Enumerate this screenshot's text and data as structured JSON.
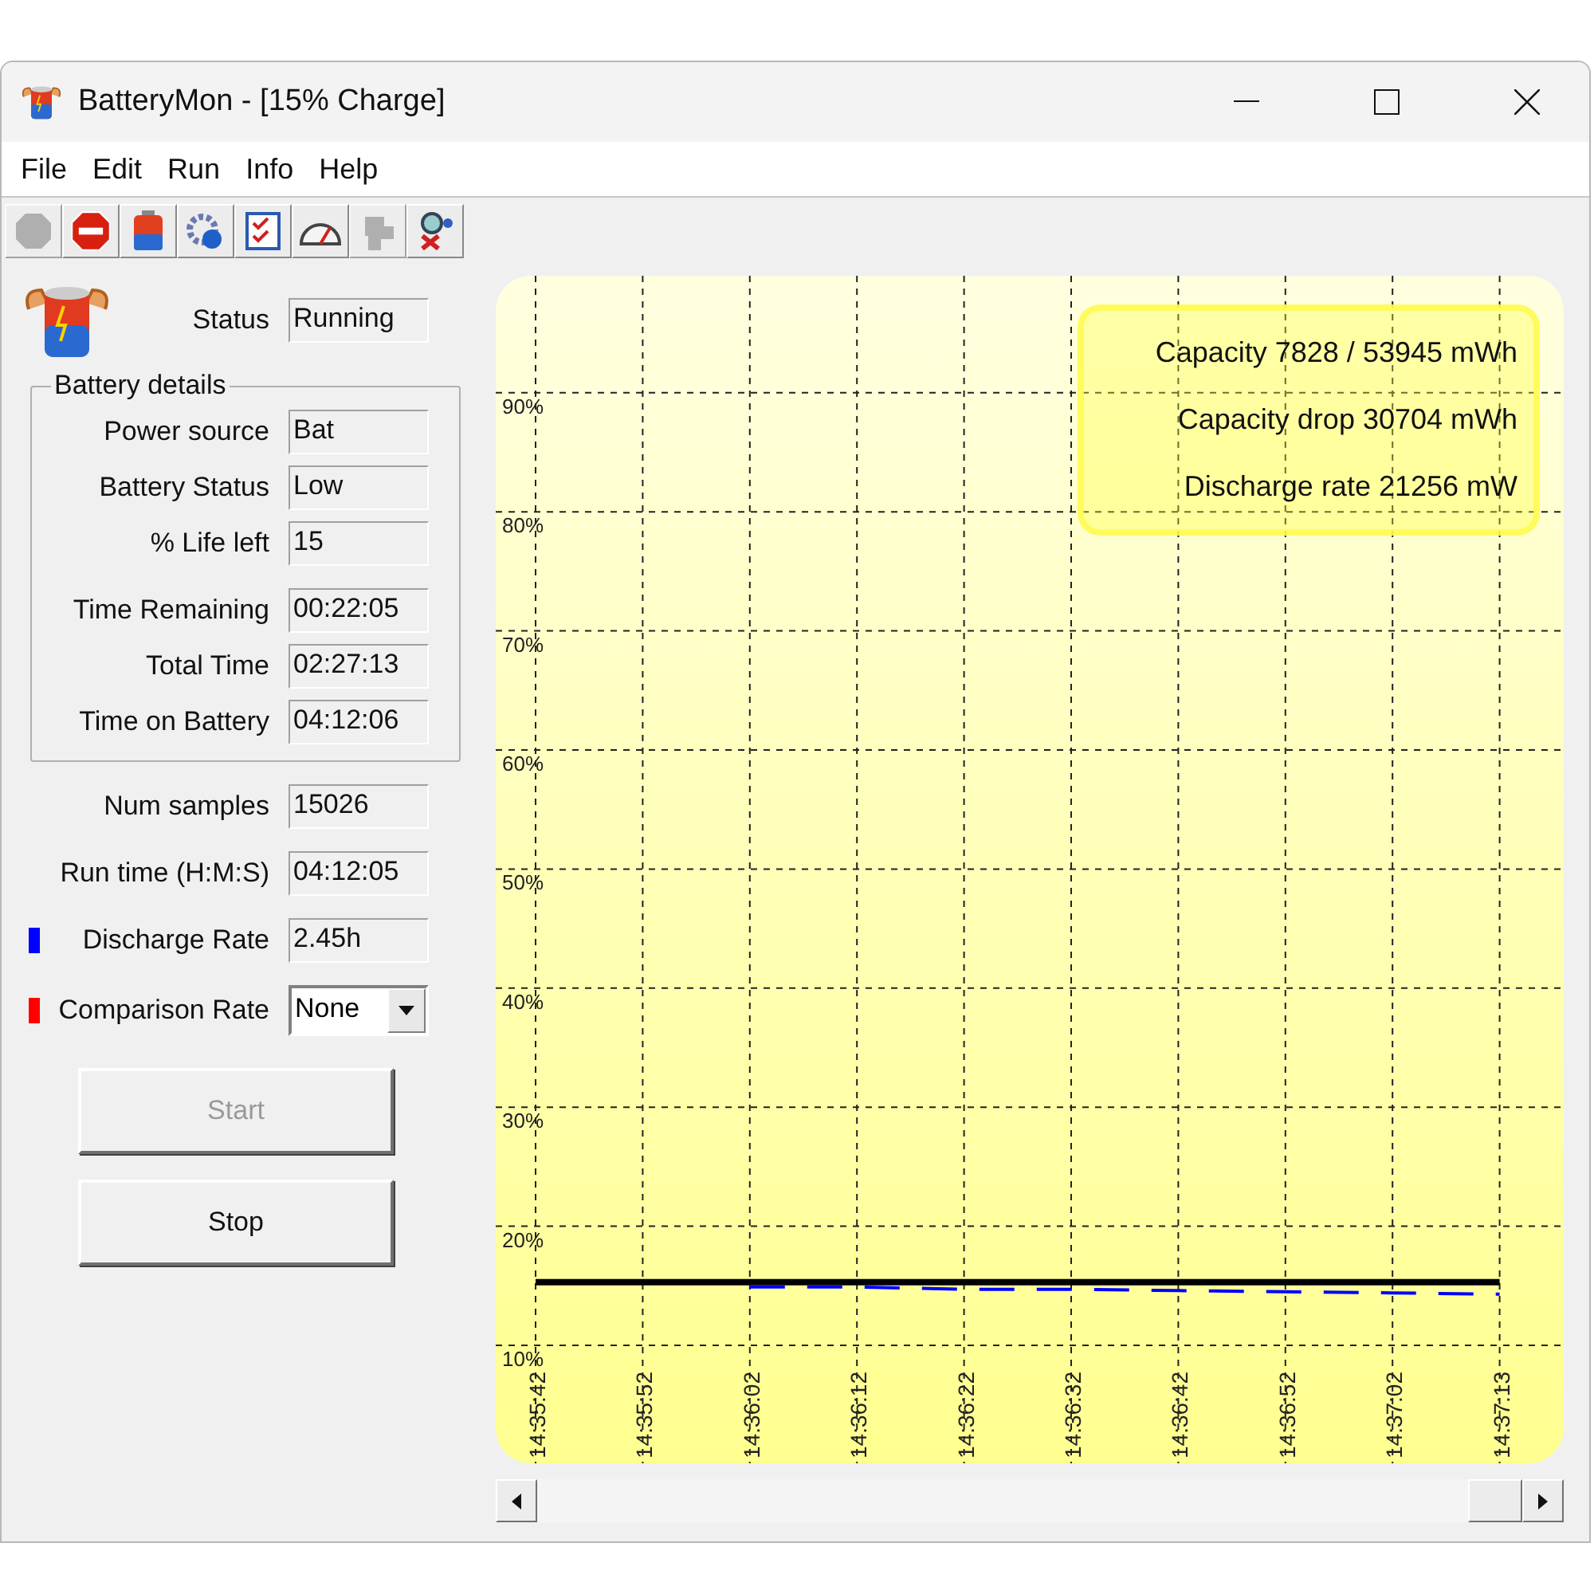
{
  "window": {
    "title": "BatteryMon - [15% Charge]"
  },
  "menu": [
    "File",
    "Edit",
    "Run",
    "Info",
    "Help"
  ],
  "toolbar": [
    {
      "kind": "octagon",
      "disabled": true
    },
    {
      "kind": "stop",
      "disabled": false
    },
    {
      "kind": "battery",
      "disabled": false
    },
    {
      "kind": "gear",
      "disabled": false
    },
    {
      "kind": "checklist",
      "disabled": false
    },
    {
      "kind": "gauge",
      "disabled": false
    },
    {
      "kind": "plug",
      "disabled": true
    },
    {
      "kind": "tools",
      "disabled": false
    }
  ],
  "status": {
    "label": "Status",
    "value": "Running"
  },
  "battery_details": {
    "title": "Battery details",
    "fields": [
      {
        "label": "Power source",
        "value": "Bat"
      },
      {
        "label": "Battery Status",
        "value": "Low"
      },
      {
        "label": "% Life left",
        "value": "15"
      },
      {
        "label": "Time Remaining",
        "value": "00:22:05"
      },
      {
        "label": "Total Time",
        "value": "02:27:13"
      },
      {
        "label": "Time on Battery",
        "value": "04:12:06"
      }
    ]
  },
  "stats": [
    {
      "label": "Num samples",
      "value": "15026"
    },
    {
      "label": "Run time (H:M:S)",
      "value": "04:12:05"
    },
    {
      "label": "Discharge Rate",
      "value": "2.45h",
      "color": "#0000ff"
    }
  ],
  "comparison": {
    "label": "Comparison Rate",
    "value": "None",
    "color": "#ff0000"
  },
  "buttons": [
    {
      "label": "Start",
      "disabled": true
    },
    {
      "label": "Stop",
      "disabled": false
    }
  ],
  "chart": {
    "info": [
      "Capacity 7828 / 53945 mWh",
      "Capacity drop 30704 mWh",
      "Discharge rate 21256 mW"
    ],
    "chart_data": {
      "type": "line",
      "grid": true,
      "categories": [
        "14:35:42",
        "14:35:52",
        "14:36:02",
        "14:36:12",
        "14:36:22",
        "14:36:32",
        "14:36:42",
        "14:36:52",
        "14:37:02",
        "14:37:13"
      ],
      "ylim": [
        0,
        100
      ],
      "yticks": [
        {
          "value": 10,
          "label": "10%"
        },
        {
          "value": 20,
          "label": "20%"
        },
        {
          "value": 30,
          "label": "30%"
        },
        {
          "value": 40,
          "label": "40%"
        },
        {
          "value": 50,
          "label": "50%"
        },
        {
          "value": 60,
          "label": "60%"
        },
        {
          "value": 70,
          "label": "70%"
        },
        {
          "value": 80,
          "label": "80%"
        },
        {
          "value": 90,
          "label": "90%"
        }
      ],
      "series": [
        {
          "color": "#000000",
          "line_style": "solid",
          "values": [
            15.3,
            15.3,
            15.3,
            15.3,
            15.3,
            15.3,
            15.3,
            15.3,
            15.3,
            15.3
          ]
        },
        {
          "color": "#0000ff",
          "line_style": "dashed",
          "values": [
            null,
            null,
            14.9,
            14.9,
            14.7,
            14.7,
            14.6,
            14.5,
            14.4,
            14.3
          ]
        }
      ]
    }
  }
}
